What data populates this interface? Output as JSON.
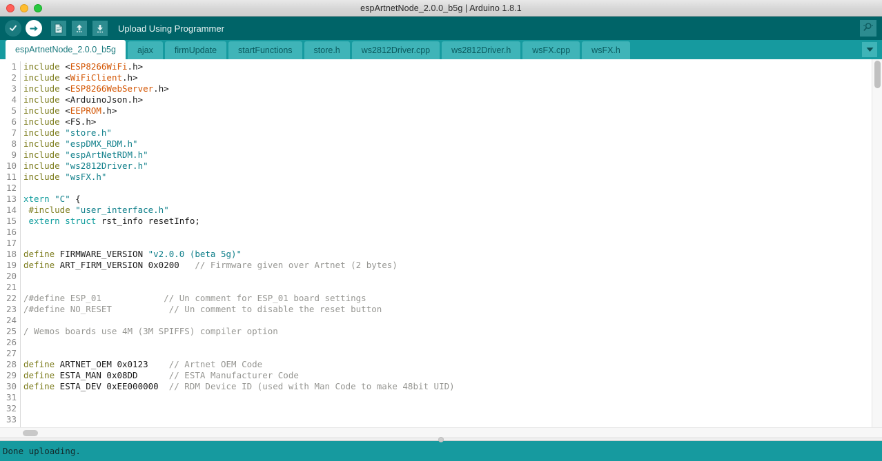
{
  "window": {
    "title": "espArtnetNode_2.0.0_b5g | Arduino 1.8.1",
    "controls": [
      {
        "name": "close",
        "color": "#ff5f57"
      },
      {
        "name": "minimize",
        "color": "#ffbd2e"
      },
      {
        "name": "maximize",
        "color": "#28c840"
      }
    ]
  },
  "toolbar": {
    "background": "#006468",
    "status_label": "Upload Using Programmer",
    "buttons": [
      {
        "icon": "verify-check-icon",
        "title": "Verify"
      },
      {
        "icon": "upload-arrow-icon",
        "title": "Upload"
      },
      {
        "icon": "new-document-icon",
        "title": "New"
      },
      {
        "icon": "open-up-arrow-icon",
        "title": "Open"
      },
      {
        "icon": "save-down-arrow-icon",
        "title": "Save"
      }
    ],
    "serial_monitor": {
      "icon": "serial-monitor-magnifier-icon",
      "title": "Serial Monitor"
    }
  },
  "tabs": {
    "background": "#169a9f",
    "active_index": 0,
    "menu_icon": "chevron-down-icon",
    "items": [
      {
        "label": "espArtnetNode_2.0.0_b5g",
        "active": true
      },
      {
        "label": "ajax",
        "active": false
      },
      {
        "label": "firmUpdate",
        "active": false
      },
      {
        "label": "startFunctions",
        "active": false
      },
      {
        "label": "store.h",
        "active": false
      },
      {
        "label": "ws2812Driver.cpp",
        "active": false
      },
      {
        "label": "ws2812Driver.h",
        "active": false
      },
      {
        "label": "wsFX.cpp",
        "active": false
      },
      {
        "label": "wsFX.h",
        "active": false
      }
    ]
  },
  "editor": {
    "first_line": 1,
    "last_line": 33,
    "lines": [
      {
        "n": 1,
        "tokens": [
          {
            "t": "include ",
            "c": "pre"
          },
          {
            "t": "<",
            "c": "txt"
          },
          {
            "t": "ESP8266WiFi",
            "c": "lib"
          },
          {
            "t": ".h>",
            "c": "txt"
          }
        ]
      },
      {
        "n": 2,
        "tokens": [
          {
            "t": "include ",
            "c": "pre"
          },
          {
            "t": "<",
            "c": "txt"
          },
          {
            "t": "WiFiClient",
            "c": "lib"
          },
          {
            "t": ".h>",
            "c": "txt"
          }
        ]
      },
      {
        "n": 3,
        "tokens": [
          {
            "t": "include ",
            "c": "pre"
          },
          {
            "t": "<",
            "c": "txt"
          },
          {
            "t": "ESP8266WebServer",
            "c": "lib"
          },
          {
            "t": ".h>",
            "c": "txt"
          }
        ]
      },
      {
        "n": 4,
        "tokens": [
          {
            "t": "include ",
            "c": "pre"
          },
          {
            "t": "<ArduinoJson.h>",
            "c": "txt"
          }
        ]
      },
      {
        "n": 5,
        "tokens": [
          {
            "t": "include ",
            "c": "pre"
          },
          {
            "t": "<",
            "c": "txt"
          },
          {
            "t": "EEPROM",
            "c": "lib"
          },
          {
            "t": ".h>",
            "c": "txt"
          }
        ]
      },
      {
        "n": 6,
        "tokens": [
          {
            "t": "include ",
            "c": "pre"
          },
          {
            "t": "<FS.h>",
            "c": "txt"
          }
        ]
      },
      {
        "n": 7,
        "tokens": [
          {
            "t": "include ",
            "c": "pre"
          },
          {
            "t": "\"store.h\"",
            "c": "str"
          }
        ]
      },
      {
        "n": 8,
        "tokens": [
          {
            "t": "include ",
            "c": "pre"
          },
          {
            "t": "\"espDMX_RDM.h\"",
            "c": "str"
          }
        ]
      },
      {
        "n": 9,
        "tokens": [
          {
            "t": "include ",
            "c": "pre"
          },
          {
            "t": "\"espArtNetRDM.h\"",
            "c": "str"
          }
        ]
      },
      {
        "n": 10,
        "tokens": [
          {
            "t": "include ",
            "c": "pre"
          },
          {
            "t": "\"ws2812Driver.h\"",
            "c": "str"
          }
        ]
      },
      {
        "n": 11,
        "tokens": [
          {
            "t": "include ",
            "c": "pre"
          },
          {
            "t": "\"wsFX.h\"",
            "c": "str"
          }
        ]
      },
      {
        "n": 12,
        "tokens": []
      },
      {
        "n": 13,
        "tokens": [
          {
            "t": "xtern ",
            "c": "kw"
          },
          {
            "t": "\"C\"",
            "c": "str"
          },
          {
            "t": " {",
            "c": "txt"
          }
        ]
      },
      {
        "n": 14,
        "tokens": [
          {
            "t": " #include ",
            "c": "pre"
          },
          {
            "t": "\"user_interface.h\"",
            "c": "str"
          }
        ]
      },
      {
        "n": 15,
        "tokens": [
          {
            "t": " ",
            "c": "txt"
          },
          {
            "t": "extern struct",
            "c": "kw"
          },
          {
            "t": " rst_info resetInfo;",
            "c": "txt"
          }
        ]
      },
      {
        "n": 16,
        "tokens": []
      },
      {
        "n": 17,
        "tokens": []
      },
      {
        "n": 18,
        "tokens": [
          {
            "t": "define",
            "c": "pre"
          },
          {
            "t": " FIRMWARE_VERSION ",
            "c": "txt"
          },
          {
            "t": "\"v2.0.0 (beta 5g)\"",
            "c": "str"
          }
        ]
      },
      {
        "n": 19,
        "tokens": [
          {
            "t": "define",
            "c": "pre"
          },
          {
            "t": " ART_FIRM_VERSION 0x0200   ",
            "c": "txt"
          },
          {
            "t": "// Firmware given over Artnet (2 bytes)",
            "c": "cmt"
          }
        ]
      },
      {
        "n": 20,
        "tokens": []
      },
      {
        "n": 21,
        "tokens": []
      },
      {
        "n": 22,
        "tokens": [
          {
            "t": "/#define ESP_01            ",
            "c": "cmt"
          },
          {
            "t": "// Un comment for ESP_01 board settings",
            "c": "cmt"
          }
        ]
      },
      {
        "n": 23,
        "tokens": [
          {
            "t": "/#define NO_RESET           ",
            "c": "cmt"
          },
          {
            "t": "// Un comment to disable the reset button",
            "c": "cmt"
          }
        ]
      },
      {
        "n": 24,
        "tokens": []
      },
      {
        "n": 25,
        "tokens": [
          {
            "t": "/ Wemos boards use 4M (3M SPIFFS) compiler option",
            "c": "cmt"
          }
        ]
      },
      {
        "n": 26,
        "tokens": []
      },
      {
        "n": 27,
        "tokens": []
      },
      {
        "n": 28,
        "tokens": [
          {
            "t": "define",
            "c": "pre"
          },
          {
            "t": " ARTNET_OEM 0x0123    ",
            "c": "txt"
          },
          {
            "t": "// Artnet OEM Code",
            "c": "cmt"
          }
        ]
      },
      {
        "n": 29,
        "tokens": [
          {
            "t": "define",
            "c": "pre"
          },
          {
            "t": " ESTA_MAN 0x08DD      ",
            "c": "txt"
          },
          {
            "t": "// ESTA Manufacturer Code",
            "c": "cmt"
          }
        ]
      },
      {
        "n": 30,
        "tokens": [
          {
            "t": "define",
            "c": "pre"
          },
          {
            "t": " ESTA_DEV 0xEE000000  ",
            "c": "txt"
          },
          {
            "t": "// RDM Device ID (used with Man Code to make 48bit UID)",
            "c": "cmt"
          }
        ]
      },
      {
        "n": 31,
        "tokens": []
      },
      {
        "n": 32,
        "tokens": []
      },
      {
        "n": 33,
        "tokens": []
      }
    ]
  },
  "console": {
    "background": "#169a9f",
    "message": "Done uploading."
  }
}
